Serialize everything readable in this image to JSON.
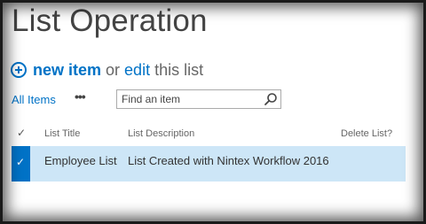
{
  "page": {
    "title": "List Operation"
  },
  "command_bar": {
    "new_item_label": "new item",
    "or_text": "or",
    "edit_label": "edit",
    "this_list_text": "this list"
  },
  "views": {
    "current_view": "All Items",
    "more_label": "•••"
  },
  "search": {
    "placeholder": "Find an item",
    "value": ""
  },
  "table": {
    "columns": [
      "List Title",
      "List Description",
      "Delete List?"
    ],
    "rows": [
      {
        "selected": true,
        "list_title": "Employee List",
        "list_description": "List Created with Nintex Workflow 2016",
        "delete_list": ""
      }
    ]
  },
  "colors": {
    "accent": "#0072c6",
    "selected_row": "#cde6f7",
    "title_text": "#444444"
  },
  "icons": [
    "plus-circle-icon",
    "search-icon",
    "checkmark-icon"
  ]
}
